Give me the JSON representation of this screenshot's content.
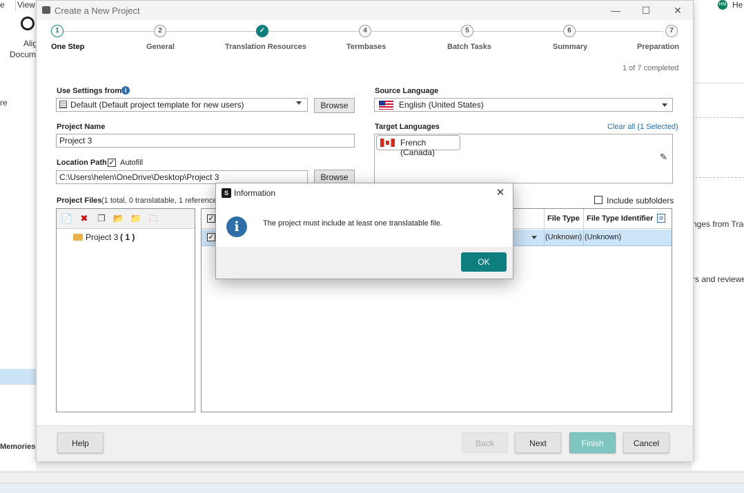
{
  "background": {
    "menu_view": "View",
    "menu_e": "e",
    "ribbon_label1": "Alig",
    "ribbon_label2": "Docum",
    "left_text_re": "re",
    "left_memories": "Memories",
    "right_text1": "nges from Trac",
    "right_text2": "rs and reviewe",
    "right_user": "He",
    "avatar_initials": "HM"
  },
  "window": {
    "title": "Create a New Project",
    "minimize": "—",
    "maximize": "☐",
    "close": "✕"
  },
  "steps": [
    {
      "number": "1",
      "label": "One Step",
      "state": "active"
    },
    {
      "number": "2",
      "label": "General",
      "state": "pending"
    },
    {
      "number": "✓",
      "label": "Translation Resources",
      "state": "done"
    },
    {
      "number": "4",
      "label": "Termbases",
      "state": "pending"
    },
    {
      "number": "5",
      "label": "Batch Tasks",
      "state": "pending"
    },
    {
      "number": "6",
      "label": "Summary",
      "state": "pending"
    },
    {
      "number": "7",
      "label": "Preparation",
      "state": "pending"
    }
  ],
  "progress_text": "1 of 7 completed",
  "use_settings": {
    "label": "Use Settings from",
    "value": "Default (Default project template for new users)",
    "browse": "Browse"
  },
  "project_name": {
    "label": "Project Name",
    "value": "Project 3"
  },
  "location_path": {
    "label": "Location Path",
    "autofill_label": "Autofill",
    "value": "C:\\Users\\helen\\OneDrive\\Desktop\\Project 3",
    "browse": "Browse"
  },
  "source_language": {
    "label": "Source Language",
    "value": "English (United States)"
  },
  "target_languages": {
    "label": "Target Languages",
    "clear_all": "Clear all (1 Selected)",
    "items": [
      "French (Canada)"
    ]
  },
  "project_files": {
    "label": "Project Files",
    "summary": "(1 total, 0 translatable, 1 reference)",
    "include_subfolders": "Include subfolders",
    "tree_item": "Project 3",
    "tree_count": "( 1 )",
    "columns": [
      "File Type",
      "File Type Identifier"
    ],
    "row": {
      "file_type": "(Unknown)",
      "file_type_identifier": "(Unknown)"
    }
  },
  "footer": {
    "help": "Help",
    "back": "Back",
    "next": "Next",
    "finish": "Finish",
    "cancel": "Cancel"
  },
  "dialog": {
    "title": "Information",
    "app_icon_letter": "S",
    "message": "The project must include at least one translatable file.",
    "ok": "OK"
  },
  "colors": {
    "accent": "#0f7e7e",
    "link": "#1f6fb2",
    "selected_row": "#cce4f7",
    "info_icon": "#2f6fa8"
  }
}
